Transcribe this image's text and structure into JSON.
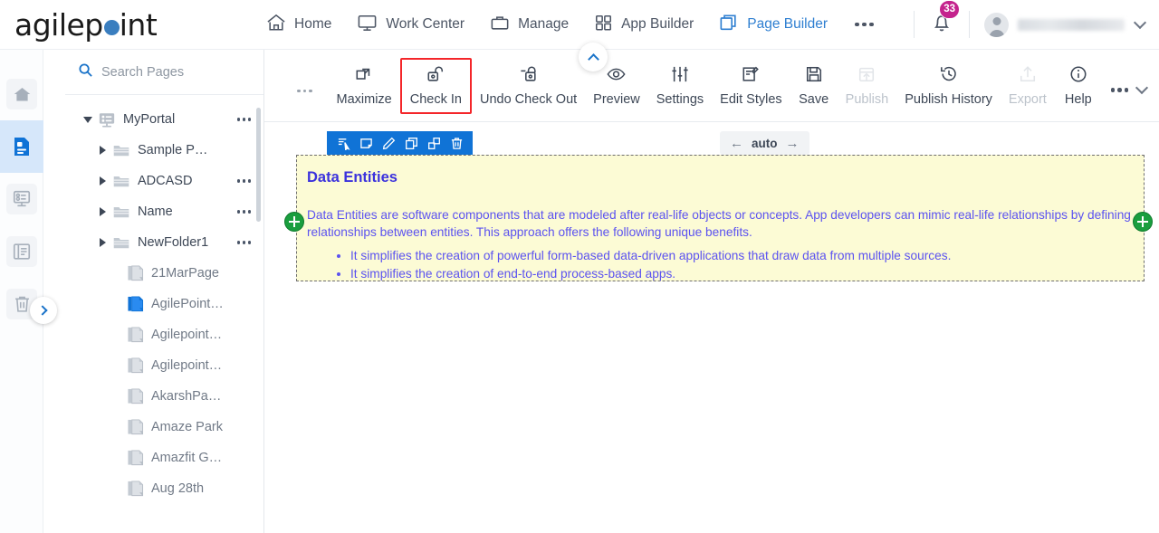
{
  "brand": {
    "text_before": "agilep",
    "text_after": "int",
    "dot_color": "#3a7ebf"
  },
  "header": {
    "nav": [
      {
        "label": "Home",
        "icon": "home-icon",
        "active": false
      },
      {
        "label": "Work Center",
        "icon": "monitor-icon",
        "active": false
      },
      {
        "label": "Manage",
        "icon": "briefcase-icon",
        "active": false
      },
      {
        "label": "App Builder",
        "icon": "grid-icon",
        "active": false
      },
      {
        "label": "Page Builder",
        "icon": "pages-icon",
        "active": true
      }
    ],
    "overflow_label": "more-menu",
    "notifications": {
      "count": "33",
      "badge_color": "#c4238d",
      "icon": "bell-icon"
    },
    "profile": {
      "username": "",
      "icon": "avatar-icon",
      "chevron": "chevron-down-icon"
    },
    "active_color": "#2f7fd1"
  },
  "rail": {
    "items": [
      {
        "name": "home",
        "icon": "home-icon",
        "active": false
      },
      {
        "name": "pages",
        "icon": "page-icon",
        "active": true
      },
      {
        "name": "forms",
        "icon": "form-icon",
        "active": false
      },
      {
        "name": "reports",
        "icon": "list-icon",
        "active": false
      },
      {
        "name": "recycle-bin",
        "icon": "trash-icon",
        "active": false
      }
    ],
    "expand": {
      "icon": "chevron-right-icon"
    }
  },
  "sidebar": {
    "search": {
      "placeholder": "Search Pages",
      "value": "",
      "icon": "search-icon"
    },
    "tree": [
      {
        "label": "MyPortal",
        "type": "portal",
        "indent": 0,
        "expander": "down",
        "menu": true,
        "selected": false
      },
      {
        "label": "Sample P…",
        "type": "folder",
        "indent": 1,
        "expander": "right",
        "menu": false,
        "selected": false
      },
      {
        "label": "ADCASD",
        "type": "folder",
        "indent": 1,
        "expander": "right",
        "menu": true,
        "selected": false
      },
      {
        "label": "Name",
        "type": "folder",
        "indent": 1,
        "expander": "right",
        "menu": true,
        "selected": false
      },
      {
        "label": "NewFolder1",
        "type": "folder",
        "indent": 1,
        "expander": "right",
        "menu": true,
        "selected": false
      },
      {
        "label": "21MarPage",
        "type": "page",
        "indent": 2,
        "expander": "none",
        "menu": false,
        "selected": false
      },
      {
        "label": "AgilePoint…",
        "type": "page",
        "indent": 2,
        "expander": "none",
        "menu": false,
        "selected": true
      },
      {
        "label": "Agilepoint…",
        "type": "page",
        "indent": 2,
        "expander": "none",
        "menu": false,
        "selected": false
      },
      {
        "label": "Agilepoint…",
        "type": "page",
        "indent": 2,
        "expander": "none",
        "menu": false,
        "selected": false
      },
      {
        "label": "AkarshPa…",
        "type": "page",
        "indent": 2,
        "expander": "none",
        "menu": false,
        "selected": false
      },
      {
        "label": "Amaze Park",
        "type": "page",
        "indent": 2,
        "expander": "none",
        "menu": false,
        "selected": false
      },
      {
        "label": "Amazfit G…",
        "type": "page",
        "indent": 2,
        "expander": "none",
        "menu": false,
        "selected": false
      },
      {
        "label": "Aug 28th",
        "type": "page",
        "indent": 2,
        "expander": "none",
        "menu": false,
        "selected": false
      }
    ]
  },
  "toolbar": {
    "overflow_left": "more-options",
    "items": [
      {
        "label": "Maximize",
        "icon": "maximize-icon",
        "disabled": false,
        "highlighted": false
      },
      {
        "label": "Check In",
        "icon": "unlock-icon",
        "disabled": false,
        "highlighted": true
      },
      {
        "label": "Undo Check Out",
        "icon": "lock-undo-icon",
        "disabled": false,
        "highlighted": false
      },
      {
        "label": "Preview",
        "icon": "eye-icon",
        "disabled": false,
        "highlighted": false
      },
      {
        "label": "Settings",
        "icon": "sliders-icon",
        "disabled": false,
        "highlighted": false
      },
      {
        "label": "Edit Styles",
        "icon": "edit-styles-icon",
        "disabled": false,
        "highlighted": false
      },
      {
        "label": "Save",
        "icon": "save-icon",
        "disabled": false,
        "highlighted": false
      },
      {
        "label": "Publish",
        "icon": "publish-icon",
        "disabled": true,
        "highlighted": false
      },
      {
        "label": "Publish History",
        "icon": "history-icon",
        "disabled": false,
        "highlighted": false
      },
      {
        "label": "Export",
        "icon": "export-icon",
        "disabled": true,
        "highlighted": false
      },
      {
        "label": "Help",
        "icon": "info-icon",
        "disabled": false,
        "highlighted": false
      }
    ],
    "highlight_color": "#f4262a",
    "collapse": {
      "icon": "chevron-up-icon"
    }
  },
  "canvas": {
    "float_toolbar": {
      "bg_color": "#1073d6",
      "buttons": [
        {
          "name": "select-parent-icon"
        },
        {
          "name": "comment-icon"
        },
        {
          "name": "edit-icon"
        },
        {
          "name": "copy-icon"
        },
        {
          "name": "duplicate-icon"
        },
        {
          "name": "delete-icon"
        }
      ]
    },
    "width_control": {
      "value": "auto",
      "left_arrow": "←",
      "right_arrow": "→"
    },
    "add_left": {
      "icon": "plus-icon"
    },
    "add_right": {
      "icon": "plus-icon"
    },
    "entity": {
      "title": "Data Entities",
      "paragraph": "Data Entities are software components that are modeled after real-life objects or concepts. App developers can mimic real-life relationships by defining relationships between entities. This approach offers the following unique benefits.",
      "bullets": [
        "It simplifies the creation of powerful form-based data-driven applications that draw data from multiple sources.",
        "It simplifies the creation of end-to-end process-based apps."
      ],
      "bg_color": "#fcfbd5",
      "title_color": "#3b32dd",
      "text_color": "#5b52f0"
    }
  }
}
